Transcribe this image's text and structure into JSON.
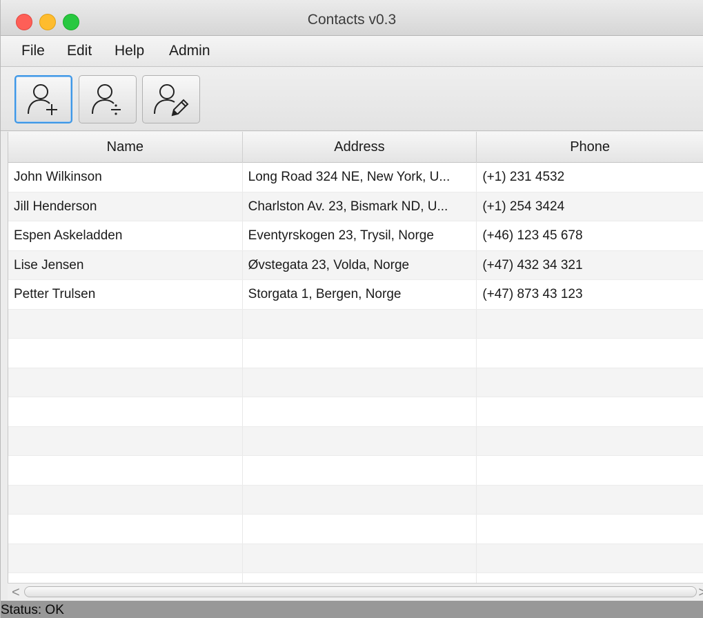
{
  "window": {
    "title": "Contacts v0.3"
  },
  "menu": {
    "items": [
      {
        "label": "File"
      },
      {
        "label": "Edit"
      },
      {
        "label": "Help"
      },
      {
        "label": "Admin"
      }
    ]
  },
  "toolbar": {
    "buttons": [
      {
        "icon": "add-user-icon",
        "focused": true
      },
      {
        "icon": "remove-user-icon",
        "focused": false
      },
      {
        "icon": "edit-user-icon",
        "focused": false
      }
    ]
  },
  "table": {
    "columns": [
      "Name",
      "Address",
      "Phone"
    ],
    "rows": [
      {
        "name": "John Wilkinson",
        "address": "Long Road 324 NE, New York, U...",
        "phone": "(+1) 231 4532"
      },
      {
        "name": "Jill Henderson",
        "address": "Charlston Av. 23, Bismark ND, U...",
        "phone": "(+1) 254 3424"
      },
      {
        "name": "Espen Askeladden",
        "address": "Eventyrskogen 23, Trysil, Norge",
        "phone": "(+46) 123 45 678"
      },
      {
        "name": "Lise Jensen",
        "address": "Øvstegata 23, Volda, Norge",
        "phone": "(+47) 432 34 321"
      },
      {
        "name": "Petter Trulsen",
        "address": "Storgata 1, Bergen, Norge",
        "phone": "(+47) 873 43 123"
      }
    ]
  },
  "scrollbar": {
    "left_arrow": "<",
    "right_arrow": ">"
  },
  "status": {
    "text": "Status: OK"
  },
  "colors": {
    "focus_ring": "#3d97e6",
    "close": "#fe5f57",
    "minimize": "#febc2e",
    "maximize": "#28c840",
    "status_bar": "#989898"
  }
}
